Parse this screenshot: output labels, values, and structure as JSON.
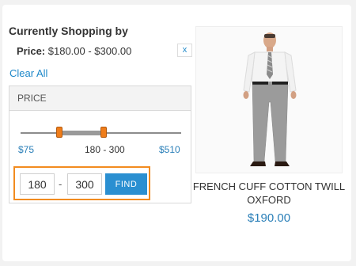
{
  "filters": {
    "title": "Currently Shopping by",
    "active": {
      "label": "Price:",
      "value": "$180.00 - $300.00",
      "remove_label": "x"
    },
    "clear_all": "Clear All"
  },
  "price_filter": {
    "heading": "PRICE",
    "min_label": "$75",
    "max_label": "$510",
    "current_range": "180 -  300",
    "from_value": "180",
    "to_value": "300",
    "range_dash": "-",
    "find_label": "FIND",
    "slider": {
      "min": 75,
      "max": 510,
      "from": 180,
      "to": 300
    },
    "highlight_color": "#f28b1f"
  },
  "product": {
    "name": "FRENCH CUFF COTTON TWILL OXFORD",
    "price": "$190.00",
    "image_icon": "man-in-shirt-and-gray-trousers"
  }
}
